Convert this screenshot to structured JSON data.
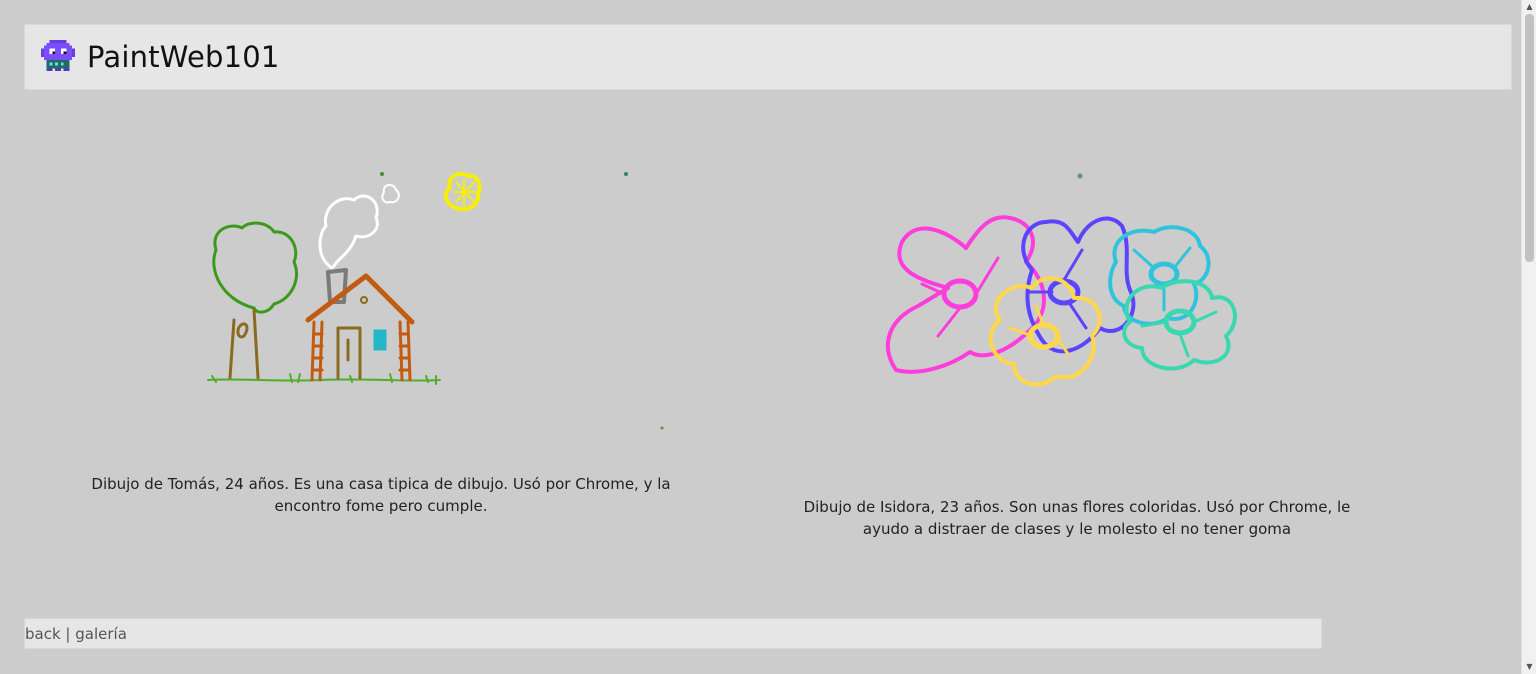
{
  "header": {
    "title": "PaintWeb101",
    "logo_icon": "pixel-monster-icon",
    "logo_color": "#7c4dff"
  },
  "gallery": [
    {
      "caption": "Dibujo de Tomás, 24 años. Es una casa tipica de dibujo. Usó por Chrome, y la encontro fome pero cumple.",
      "content": "house-tree-sun-drawing"
    },
    {
      "caption": "Dibujo de Isidora, 23 años. Son unas flores coloridas. Usó por Chrome, le ayudo a distraer de clases y le molesto el no tener goma",
      "content": "colorful-flowers-drawing"
    }
  ],
  "footer": {
    "back_label": "back",
    "separator": " | ",
    "gallery_label": "galería"
  },
  "colors": {
    "background": "#cccccc",
    "panel": "#e6e6e6"
  }
}
